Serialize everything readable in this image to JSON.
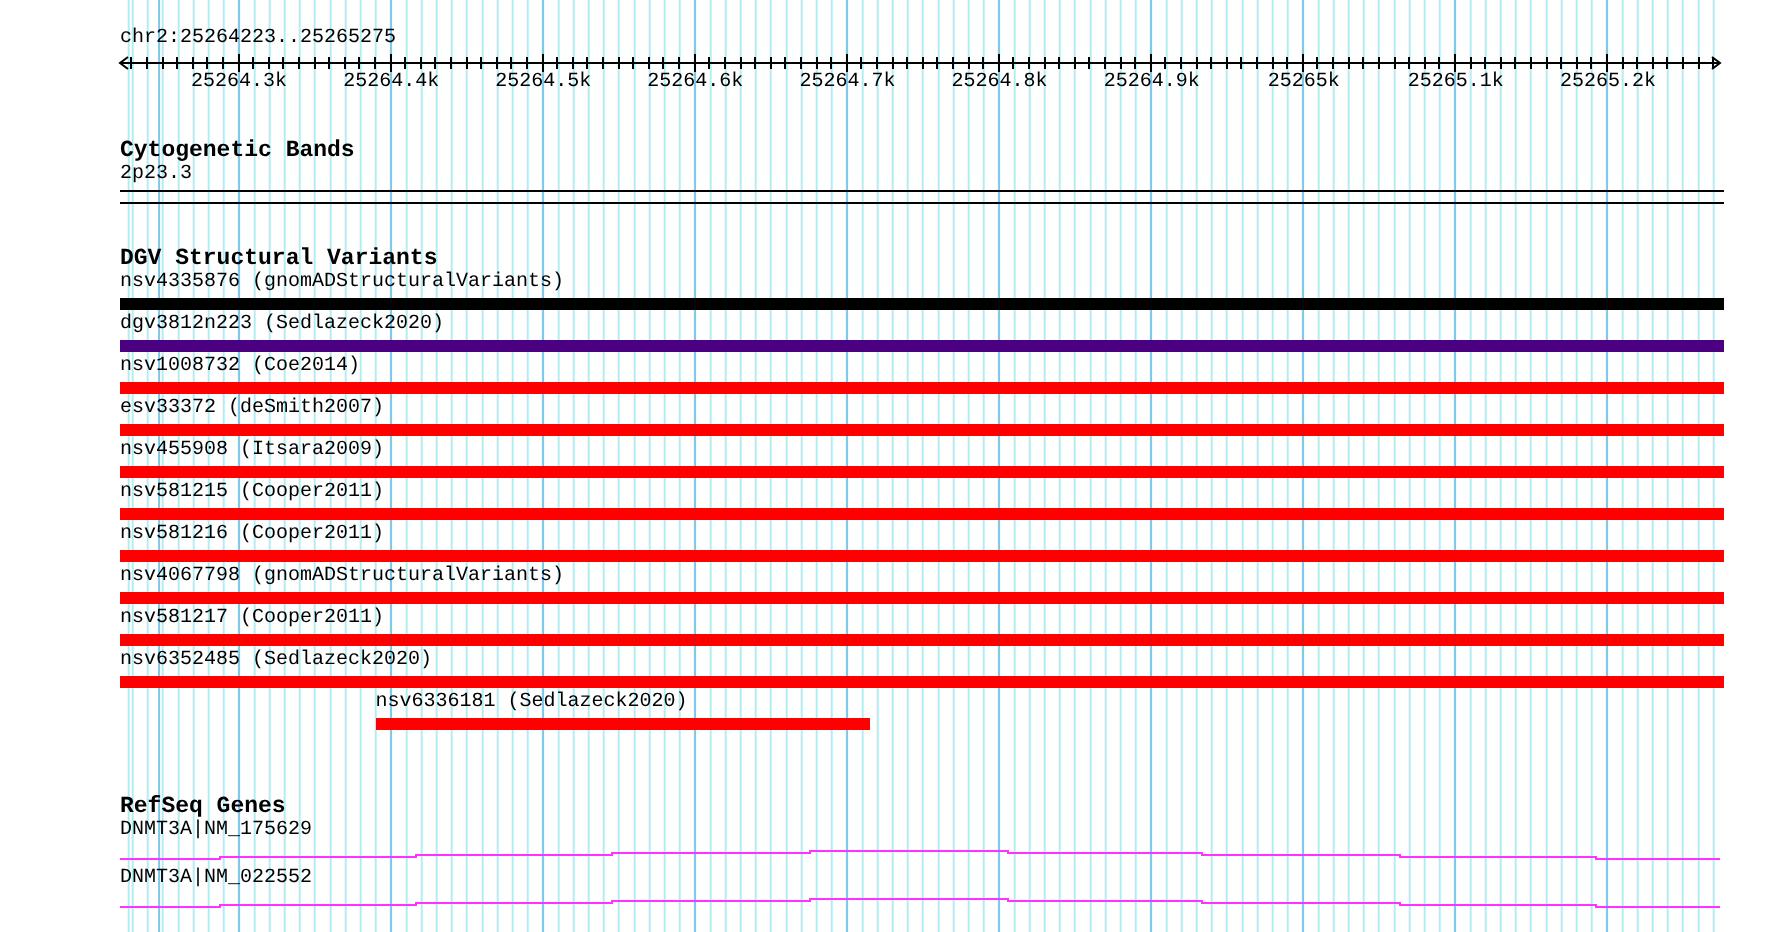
{
  "ruler": {
    "location": "chr2:25264223..25265275",
    "ticks": [
      {
        "label": "25264.3k"
      },
      {
        "label": "25264.4k"
      },
      {
        "label": "25264.5k"
      },
      {
        "label": "25264.6k"
      },
      {
        "label": "25264.7k"
      },
      {
        "label": "25264.8k"
      },
      {
        "label": "25264.9k"
      },
      {
        "label": "25265k"
      },
      {
        "label": "25265.1k"
      },
      {
        "label": "25265.2k"
      }
    ]
  },
  "cytogenetic_bands": {
    "title": "Cytogenetic Bands",
    "features": [
      {
        "label": "2p23.3"
      }
    ]
  },
  "dgv_structural_variants": {
    "title": "DGV Structural Variants",
    "variants": [
      {
        "label": "nsv4335876 (gnomADStructuralVariants)",
        "color": "#000000"
      },
      {
        "label": "dgv3812n223 (Sedlazeck2020)",
        "color": "#4b0082"
      },
      {
        "label": "nsv1008732 (Coe2014)",
        "color": "#ff0000"
      },
      {
        "label": "esv33372 (deSmith2007)",
        "color": "#ff0000"
      },
      {
        "label": "nsv455908 (Itsara2009)",
        "color": "#ff0000"
      },
      {
        "label": "nsv581215 (Cooper2011)",
        "color": "#ff0000"
      },
      {
        "label": "nsv581216 (Cooper2011)",
        "color": "#ff0000"
      },
      {
        "label": "nsv4067798 (gnomADStructuralVariants)",
        "color": "#ff0000"
      },
      {
        "label": "nsv581217 (Cooper2011)",
        "color": "#ff0000"
      },
      {
        "label": "nsv6352485 (Sedlazeck2020)",
        "color": "#ff0000"
      },
      {
        "label": "nsv6336181 (Sedlazeck2020)",
        "color": "#ff0000"
      }
    ]
  },
  "refseq_genes": {
    "title": "RefSeq Genes",
    "genes": [
      {
        "label": "DNMT3A|NM_175629"
      },
      {
        "label": "DNMT3A|NM_022552"
      }
    ]
  }
}
